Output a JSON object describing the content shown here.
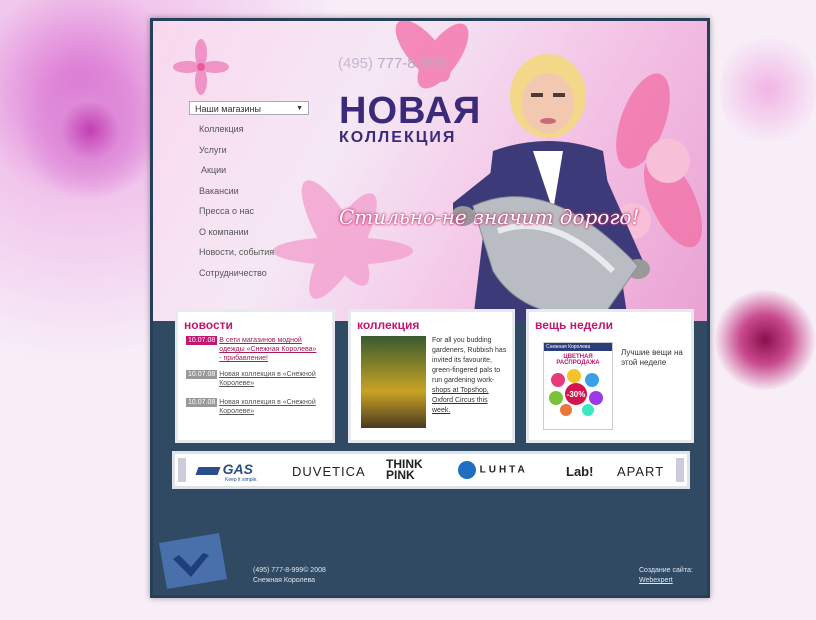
{
  "phone": {
    "prefix": "(495)",
    "number": "777-8-999"
  },
  "stores_select": {
    "value": "Наши магазины"
  },
  "menu": [
    "Коллекция",
    "Услуги",
    "Акции",
    "Вакансии",
    "Пресса о нас",
    "О компании",
    "Новости, события",
    "Сотрудничество"
  ],
  "logo": {
    "line1": "НОВАЯ",
    "line2": "КОЛЛЕКЦИЯ"
  },
  "slogan": "Стильно-не значит дорого!",
  "news": {
    "title": "новости",
    "items": [
      {
        "date": "10.07.08",
        "text": "В сети магазинов модной одежды «Снежная Королева» - прибавление!",
        "highlight": true
      },
      {
        "date": "10.07.08",
        "text": "Новая коллекция в «Снежной Королеве»",
        "highlight": false
      },
      {
        "date": "10.07.08",
        "text": "Новая коллекция в «Снежной Королеве»",
        "highlight": false
      }
    ]
  },
  "collection": {
    "title": "коллекция",
    "text_plain": "For all you budding gardeners, Rubbish has invited its favourite, green-fingered pals to run gardening work-",
    "text_link": "shops at Topshop, Oxford Circus this week."
  },
  "week": {
    "title": "вещь недели",
    "text": "Лучшие вещи на этой неделе",
    "poster_top": "Снежная Королева",
    "poster_sale": "ЦВЕТНАЯ РАСПРОДАЖА",
    "poster_pct": "-30%"
  },
  "brands": [
    {
      "name": "GAS",
      "sub": "Keep it simple."
    },
    {
      "name": "DUVETICA"
    },
    {
      "name": "THINK PINK"
    },
    {
      "name": "LUHTA"
    },
    {
      "name": "Lab!"
    },
    {
      "name": "APART"
    }
  ],
  "footer": {
    "copyright": "(495) 777-8-999© 2008",
    "company": "Снежная Королева",
    "made_label": "Создание сайта:",
    "made_link": "Webexpert"
  },
  "colors": {
    "accent": "#c2166f",
    "site_bg": "#2f4a62",
    "logo": "#3b2a79"
  }
}
